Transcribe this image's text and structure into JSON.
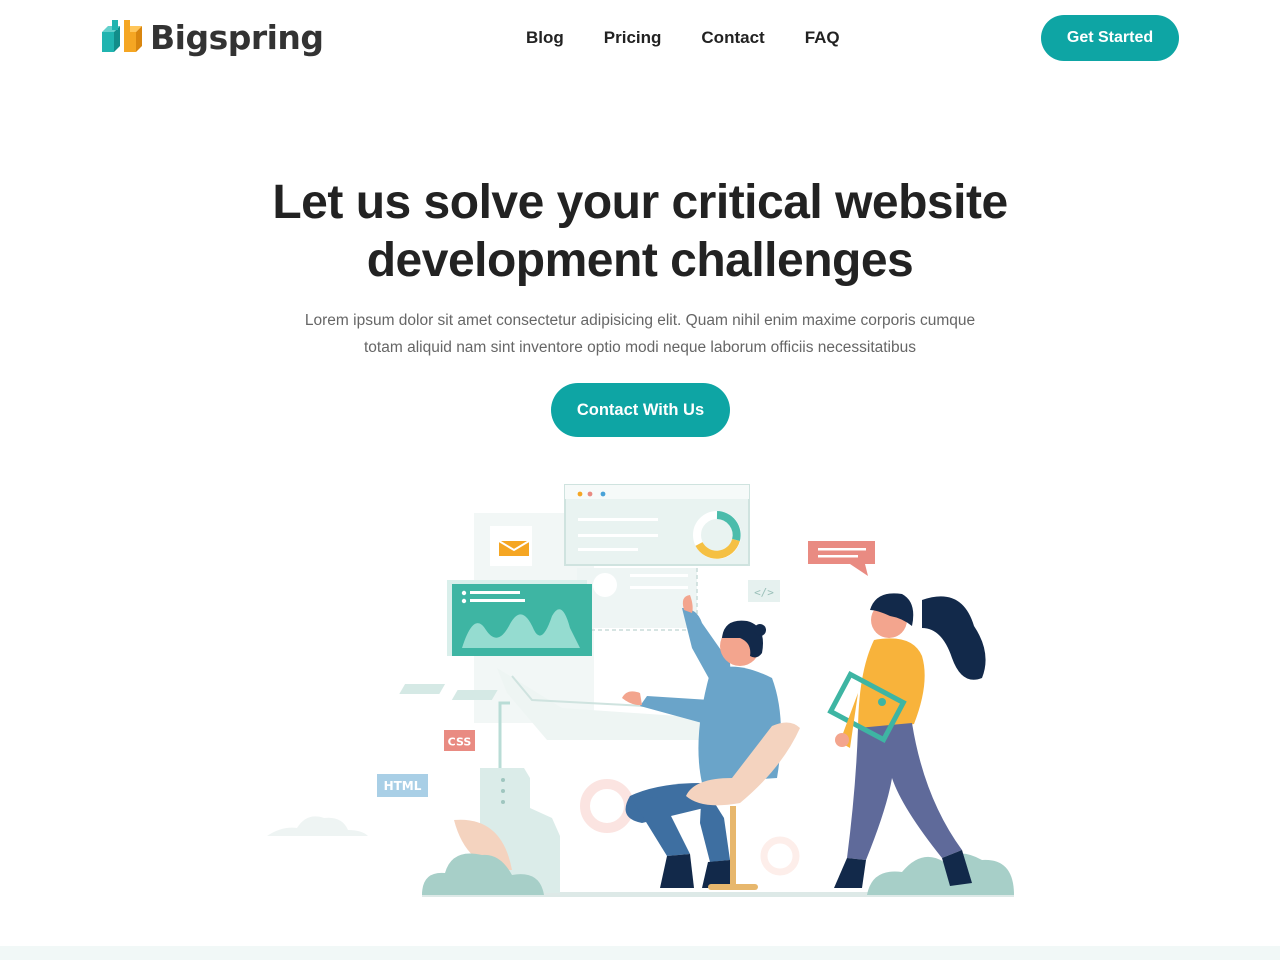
{
  "header": {
    "logo_text": "Bigspring",
    "nav": [
      "Blog",
      "Pricing",
      "Contact",
      "FAQ"
    ],
    "cta_label": "Get Started"
  },
  "hero": {
    "title_line1": "Let us solve your critical website",
    "title_line2": "development challenges",
    "subtitle_line1": "Lorem ipsum dolor sit amet consectetur adipisicing elit. Quam nihil enim maxime corporis cumque",
    "subtitle_line2": "totam aliquid nam sint inventore optio modi neque laborum officiis necessitatibus",
    "cta_label": "Contact With Us"
  },
  "illustration": {
    "tags": {
      "css": "CSS",
      "html": "HTML",
      "code": "</>"
    }
  },
  "colors": {
    "accent": "#0ea5a4",
    "logo_teal": "#20b4b0",
    "logo_orange": "#f5a623",
    "heading": "#222222",
    "body_text": "#666666"
  }
}
